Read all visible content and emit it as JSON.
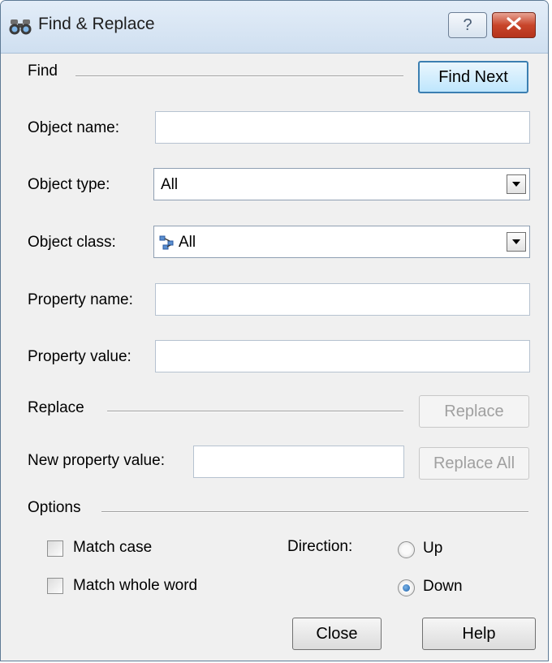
{
  "window": {
    "title": "Find & Replace",
    "help_button": "?",
    "close_icon": "close-icon"
  },
  "find": {
    "section_label": "Find",
    "find_next_button": "Find Next",
    "object_name_label": "Object name:",
    "object_name_value": "",
    "object_type_label": "Object type:",
    "object_type_value": "All",
    "object_class_label": "Object class:",
    "object_class_value": "All",
    "property_name_label": "Property name:",
    "property_name_value": "",
    "property_value_label": "Property value:",
    "property_value_value": ""
  },
  "replace": {
    "section_label": "Replace",
    "replace_button": "Replace",
    "new_property_value_label": "New property value:",
    "new_property_value_value": "",
    "replace_all_button": "Replace All"
  },
  "options": {
    "section_label": "Options",
    "match_case_label": "Match case",
    "match_case_checked": false,
    "match_whole_word_label": "Match whole word",
    "match_whole_word_checked": false,
    "direction_label": "Direction:",
    "up_label": "Up",
    "down_label": "Down",
    "direction_selected": "Down"
  },
  "footer": {
    "close_button": "Close",
    "help_button": "Help"
  },
  "colors": {
    "title_bar": "#cfdff0",
    "dialog_bg": "#f0f0f0",
    "close_button_red": "#c8452a",
    "default_button_border": "#3c7fb1",
    "disabled_text": "#a0a0a0"
  }
}
